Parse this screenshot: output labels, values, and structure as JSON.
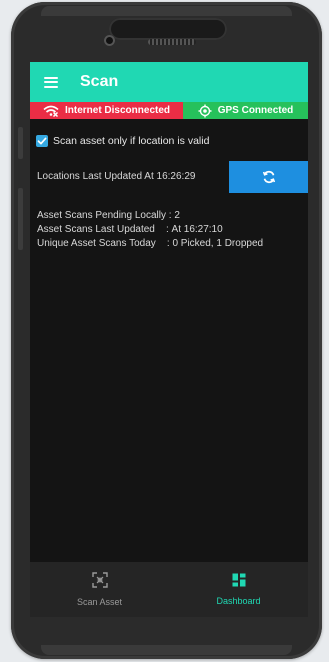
{
  "app_bar": {
    "title": "Scan",
    "menu_icon": "hamburger-menu-icon"
  },
  "status": {
    "internet": {
      "label": "Internet Disconnected",
      "icon": "wifi-off-icon",
      "color": "#ea2d45"
    },
    "gps": {
      "label": "GPS Connected",
      "icon": "gps-target-icon",
      "color": "#26c15b"
    }
  },
  "options": {
    "scan_valid_location": {
      "label": "Scan asset only if location is valid",
      "checked": true
    }
  },
  "locations": {
    "label": "Locations Last Updated At 16:26:29",
    "refresh_icon": "sync-icon"
  },
  "stats": [
    {
      "key": "Asset Scans Pending Locally",
      "sep": " : ",
      "value": "2"
    },
    {
      "key": "Asset Scans Last Updated",
      "sep": "    : ",
      "value": "At 16:27:10"
    },
    {
      "key": "Unique Asset Scans Today",
      "sep": "    : ",
      "value": "0 Picked, 1 Dropped"
    }
  ],
  "bottom_nav": {
    "items": [
      {
        "label": "Scan Asset",
        "icon": "scan-qr-icon",
        "active": false
      },
      {
        "label": "Dashboard",
        "icon": "dashboard-grid-icon",
        "active": true
      }
    ]
  },
  "colors": {
    "accent": "#20d8b3",
    "primary_button": "#1e8fe0",
    "checkbox": "#35a9e2",
    "screen_bg": "#141414"
  }
}
